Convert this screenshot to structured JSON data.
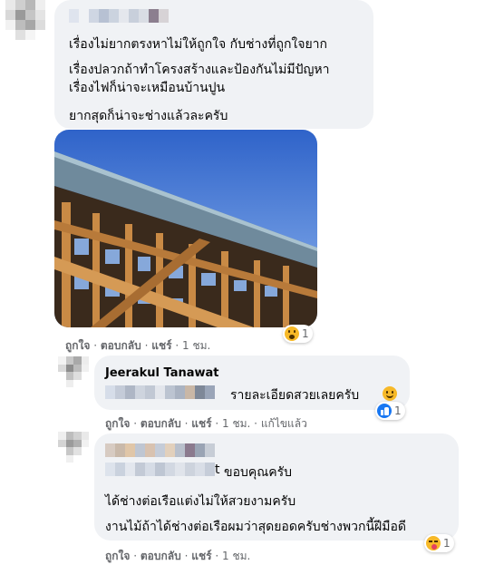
{
  "comment1": {
    "lines": [
      "เรื่องไม่ยากตรงหาไม่ให้ถูกใจ กับช่างที่ถูกใจยาก",
      "เรื่องปลวกถ้าทำโครงสร้างและป้องกันไม่มีปัญหา",
      "เรื่องไฟก็น่าจะเหมือนบ้านปูน",
      "ยากสุดก็น่าจะช่างแล้วละครับ"
    ],
    "actions": {
      "like": "ถูกใจ",
      "reply": "ตอบกลับ",
      "share": "แชร์",
      "time": "1 ชม."
    },
    "reaction": {
      "icon": "wow-emoji-icon",
      "count": "1"
    }
  },
  "reply1": {
    "author": "Jeerakul Tanawat",
    "text": "รายละเอียดสวยเลยครับ",
    "emoji": "smile-emoji-icon",
    "actions": {
      "like": "ถูกใจ",
      "reply": "ตอบกลับ",
      "share": "แชร์",
      "time": "1 ชม.",
      "edited": "แก้ไขแล้ว"
    },
    "reaction": {
      "icon": "like-reaction-icon",
      "count": "1"
    }
  },
  "reply2": {
    "name_suffix": "t",
    "lines": [
      "ขอบคุณครับ",
      "ได้ช่างต่อเรือแต่งไม่ให้สวยงามครับ",
      "งานไม้ถ้าได้ช่างต่อเรือผมว่าสุดยอดครับช่างพวกนี้ฝีมือดี"
    ],
    "actions": {
      "like": "ถูกใจ",
      "reply": "ตอบกลับ",
      "share": "แชร์",
      "time": "1 ชม."
    },
    "reaction": {
      "icon": "laugh-kiss-emoji-icon",
      "count": "1"
    }
  },
  "colors": {
    "bubble": "#f0f2f5",
    "meta": "#65676b",
    "like_blue": "#1877f2",
    "emoji_yellow": "#f7b928"
  }
}
